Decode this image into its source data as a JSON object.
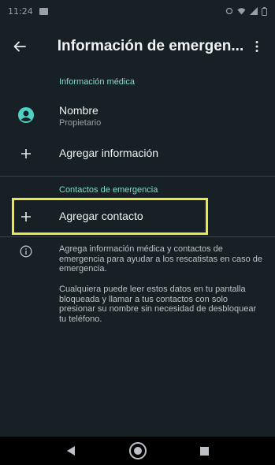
{
  "status_bar": {
    "time": "11:24"
  },
  "app_bar": {
    "title": "Información de emergen...",
    "back_icon": "arrow-left-icon",
    "menu_icon": "more-vert-icon"
  },
  "medical_info": {
    "section_title": "Información médica",
    "name_label": "Nombre",
    "name_value": "Propietario",
    "add_info_label": "Agregar información"
  },
  "emergency_contacts": {
    "section_title": "Contactos de emergencia",
    "add_contact_label": "Agregar contacto"
  },
  "info_footer": {
    "paragraph_1": "Agrega información médica y contactos de emergencia para ayudar a los rescatistas en caso de emergencia.",
    "paragraph_2": "Cualquiera puede leer estos datos en tu pantalla bloqueada y llamar a tus contactos con solo presionar su nombre sin necesidad de desbloquear tu teléfono."
  },
  "colors": {
    "background": "#172125",
    "accent": "#7fdccf",
    "highlight": "#e9e84b"
  }
}
